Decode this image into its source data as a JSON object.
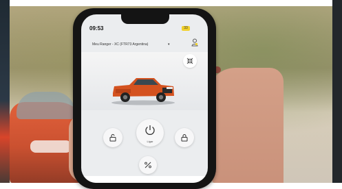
{
  "status_bar": {
    "time": "09:53",
    "battery": "33"
  },
  "header": {
    "vehicle_name": "Meu Ranger - XC (FTR73 Argentina)",
    "caret": "▾"
  },
  "remote": {
    "start_label": "Ligar"
  },
  "colors": {
    "truck": "#d4521f",
    "accent": "#f2d12b",
    "screen_bg": "#ebedef"
  },
  "icons": {
    "profile": "person-icon",
    "expand": "collapse-arrows-icon",
    "unlock": "unlock-icon",
    "start": "power-icon",
    "lock": "lock-icon",
    "climate": "fan-icon"
  }
}
